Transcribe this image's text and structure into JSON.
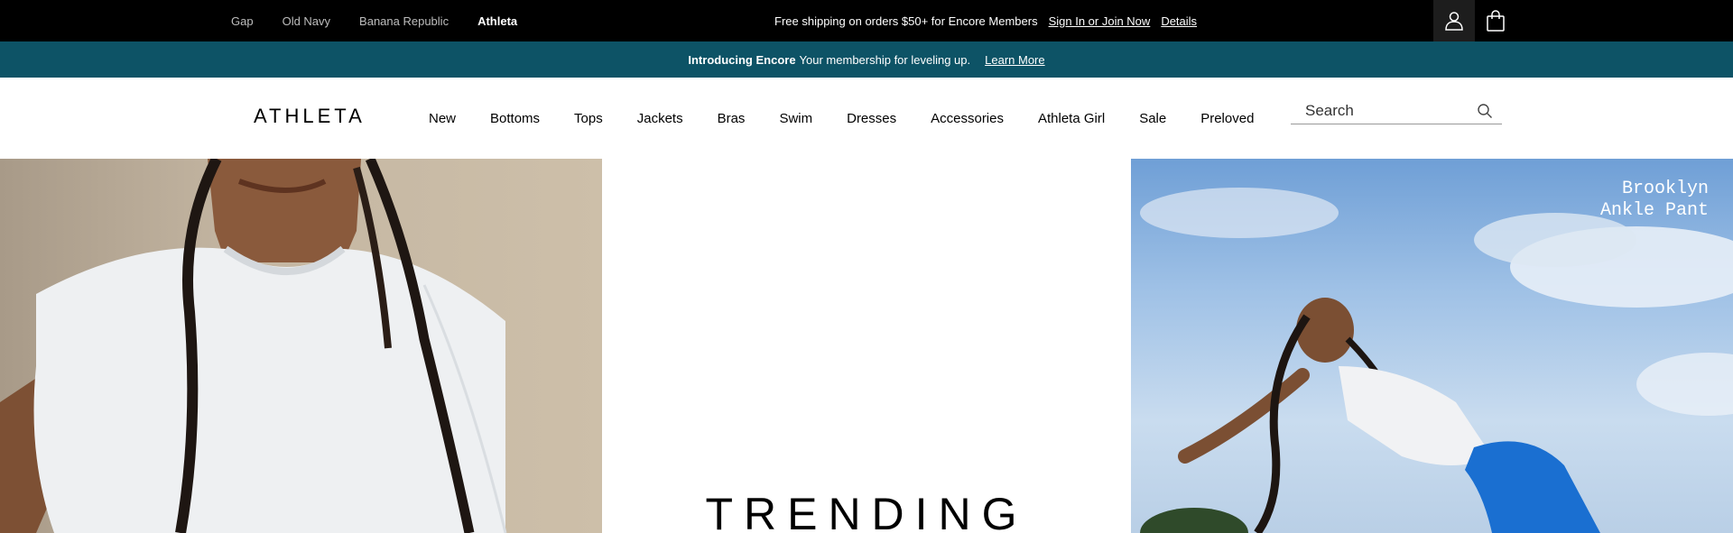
{
  "topbar": {
    "brands": [
      {
        "label": "Gap"
      },
      {
        "label": "Old Navy"
      },
      {
        "label": "Banana Republic"
      },
      {
        "label": "Athleta"
      }
    ],
    "promo_text": "Free shipping on orders $50+ for Encore Members",
    "signin_label": "Sign In or Join Now",
    "details_label": "Details",
    "icons": {
      "account": "user-icon",
      "bag": "shopping-bag-icon"
    }
  },
  "encore": {
    "bold": "Introducing Encore",
    "message": "Your membership for leveling up.",
    "link": "Learn More",
    "bg_color": "#0d5366"
  },
  "header": {
    "logo": "ATHLETA",
    "menu": [
      "New",
      "Bottoms",
      "Tops",
      "Jackets",
      "Bras",
      "Swim",
      "Dresses",
      "Accessories",
      "Athleta Girl",
      "Sale",
      "Preloved"
    ],
    "search_placeholder": "Search",
    "search_icon": "search-icon"
  },
  "hero": {
    "heading": "TRENDING",
    "product_label": "Brooklyn\nAnkle Pant"
  }
}
